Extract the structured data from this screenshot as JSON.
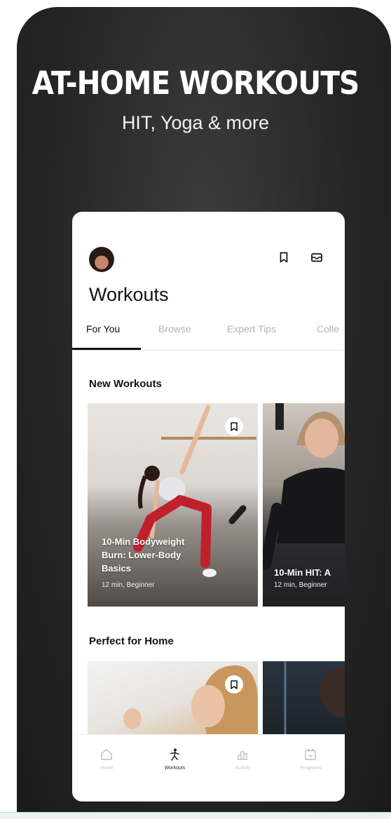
{
  "promo": {
    "headline": "AT-HOME WORKOUTS",
    "subheadline": "HIT, Yoga & more"
  },
  "app": {
    "title": "Workouts",
    "header_icons": [
      "bookmark-icon",
      "inbox-icon"
    ],
    "tabs": [
      {
        "label": "For You",
        "active": true
      },
      {
        "label": "Browse",
        "active": false
      },
      {
        "label": "Expert Tips",
        "active": false
      },
      {
        "label": "Colle",
        "active": false
      }
    ],
    "sections": [
      {
        "title": "New Workouts",
        "cards": [
          {
            "title_line1": "10-Min Bodyweight",
            "title_line2": "Burn: Lower-Body",
            "title_line3": "Basics",
            "meta": "12 min, Beginner"
          },
          {
            "title_line1": "10-Min HIT: A",
            "meta": "12 min, Beginner"
          }
        ]
      },
      {
        "title": "Perfect for Home"
      }
    ],
    "nav": [
      {
        "label": "Home",
        "icon": "home-icon",
        "active": false
      },
      {
        "label": "Workouts",
        "icon": "runner-icon",
        "active": true
      },
      {
        "label": "Activity",
        "icon": "bar-chart-icon",
        "active": false
      },
      {
        "label": "Programs",
        "icon": "calendar-icon",
        "active": false
      }
    ],
    "colors": {
      "accent": "#111111",
      "background": "#ffffff",
      "promo_bg": "#262626"
    }
  }
}
